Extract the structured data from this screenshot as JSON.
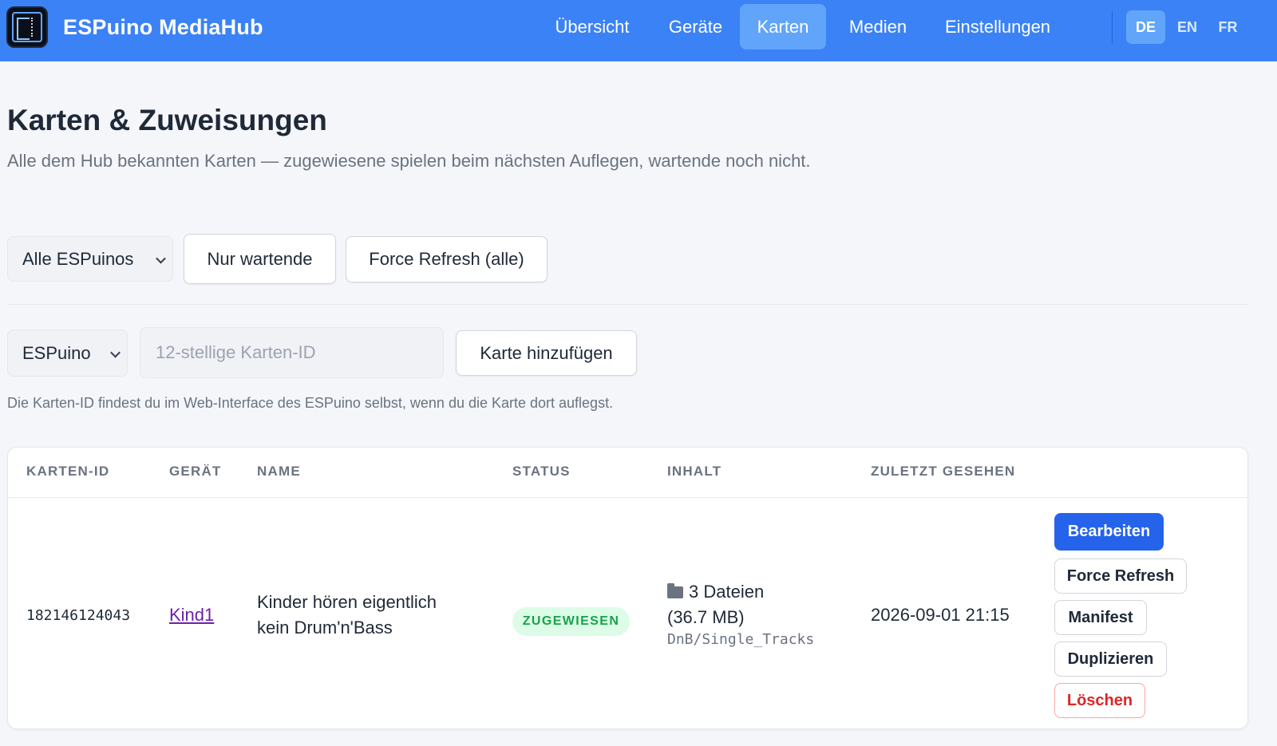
{
  "app": {
    "title": "ESPuino MediaHub",
    "brand_color": "#3b82f6",
    "logo_icon": "esp32-chip-logo"
  },
  "nav": {
    "items": [
      {
        "label": "Übersicht",
        "active": false
      },
      {
        "label": "Geräte",
        "active": false
      },
      {
        "label": "Karten",
        "active": true
      },
      {
        "label": "Medien",
        "active": false
      },
      {
        "label": "Einstellungen",
        "active": false
      }
    ],
    "languages": [
      {
        "label": "DE",
        "active": true
      },
      {
        "label": "EN",
        "active": false
      },
      {
        "label": "FR",
        "active": false
      }
    ]
  },
  "page": {
    "title": "Karten & Zuweisungen",
    "subtitle": "Alle dem Hub bekannten Karten — zugewiesene spielen beim nächsten Auflegen, wartende noch nicht."
  },
  "filters": {
    "device_select": "Alle ESPuinos",
    "only_waiting_label": "Nur wartende",
    "force_refresh_all_label": "Force Refresh (alle)"
  },
  "add_card": {
    "device_select": "ESPuino",
    "card_id_placeholder": "12-stellige Karten-ID",
    "add_button_label": "Karte hinzufügen",
    "hint": "Die Karten-ID findest du im Web-Interface des ESPuino selbst, wenn du die Karte dort auflegst."
  },
  "table": {
    "headers": [
      "KARTEN-ID",
      "GERÄT",
      "NAME",
      "STATUS",
      "INHALT",
      "ZULETZT GESEHEN"
    ],
    "rows": [
      {
        "card_id": "182146124043",
        "device": "Kind1",
        "name_line1": "Kinder hören eigentlich",
        "name_line2": "kein Drum'n'Bass",
        "status": "ZUGEWIESEN",
        "status_color": "#16a34a",
        "content_line1": "3 Dateien",
        "content_line2": "(36.7 MB)",
        "content_path": "DnB/Single_Tracks",
        "last_seen": "2026-09-01 21:15",
        "actions": {
          "edit": "Bearbeiten",
          "force_refresh": "Force Refresh",
          "manifest": "Manifest",
          "duplicate": "Duplizieren",
          "delete": "Löschen"
        }
      }
    ]
  }
}
